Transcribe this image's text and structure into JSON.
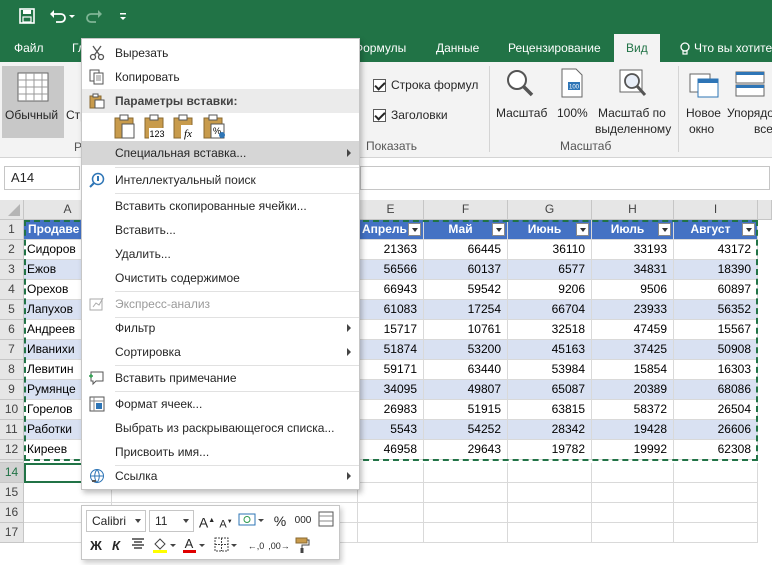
{
  "qat": {
    "save_icon": "save-icon",
    "undo_icon": "undo-icon",
    "redo_icon": "redo-icon",
    "customize_icon": "customize-qat-icon"
  },
  "tabs": [
    {
      "label": "Файл"
    },
    {
      "label": "Гл"
    },
    {
      "label": "Формулы"
    },
    {
      "label": "Данные"
    },
    {
      "label": "Рецензирование"
    },
    {
      "label": "Вид"
    },
    {
      "label": "Что вы хотите"
    }
  ],
  "ribbon": {
    "normal_label": "Обычный",
    "page_label_partial": "Стр",
    "group_partial": "Р",
    "formula_bar_label": "Строка формул",
    "headings_label": "Заголовки",
    "show_group": "Показать",
    "zoom_label": "Масштаб",
    "zoom100_label": "100%",
    "zoom_sel_line1": "Масштаб по",
    "zoom_sel_line2": "выделенному",
    "zoom_group": "Масштаб",
    "new_window_line1": "Новое",
    "new_window_line2": "окно",
    "arrange_line1": "Упорядо",
    "arrange_line2": "все"
  },
  "name_box": "A14",
  "columns": [
    "A",
    "E",
    "F",
    "G",
    "H",
    "I"
  ],
  "table": {
    "headers": [
      "Продаве",
      "Апрель",
      "Май",
      "Июнь",
      "Июль",
      "Август"
    ],
    "rows": [
      [
        "Сидоров",
        "21363",
        "66445",
        "36110",
        "33193",
        "43172"
      ],
      [
        "Ежов",
        "56566",
        "60137",
        "6577",
        "34831",
        "18390"
      ],
      [
        "Орехов",
        "66943",
        "59542",
        "9206",
        "9506",
        "60897"
      ],
      [
        "Лапухов",
        "61083",
        "17254",
        "66704",
        "23933",
        "56352"
      ],
      [
        "Андреев",
        "15717",
        "10761",
        "32518",
        "47459",
        "15567"
      ],
      [
        "Иванихи",
        "51874",
        "53200",
        "45163",
        "37425",
        "50908"
      ],
      [
        "Левитин",
        "59171",
        "63440",
        "53984",
        "15854",
        "16303"
      ],
      [
        "Румянце",
        "34095",
        "49807",
        "65087",
        "20389",
        "68086"
      ],
      [
        "Горелов",
        "26983",
        "51915",
        "63815",
        "58372",
        "26504"
      ],
      [
        "Работки",
        "5543",
        "54252",
        "28342",
        "19428",
        "26606"
      ],
      [
        "Киреев",
        "46958",
        "29643",
        "19782",
        "19992",
        "62308"
      ]
    ]
  },
  "row_numbers": [
    "1",
    "2",
    "3",
    "4",
    "5",
    "6",
    "7",
    "8",
    "9",
    "10",
    "11",
    "12",
    "14",
    "15",
    "16",
    "17"
  ],
  "context_menu": {
    "cut": "Вырезать",
    "copy": "Копировать",
    "paste_options": "Параметры вставки:",
    "paste_special": "Специальная вставка...",
    "smart_lookup": "Интеллектуальный поиск",
    "insert_copied": "Вставить скопированные ячейки...",
    "insert": "Вставить...",
    "delete": "Удалить...",
    "clear": "Очистить содержимое",
    "quick_analysis": "Экспресс-анализ",
    "filter": "Фильтр",
    "sort": "Сортировка",
    "insert_comment": "Вставить примечание",
    "format_cells": "Формат ячеек...",
    "pick_list": "Выбрать из раскрывающегося списка...",
    "define_name": "Присвоить имя...",
    "link": "Ссылка"
  },
  "mini_toolbar": {
    "font": "Calibri",
    "size": "11",
    "bold": "Ж",
    "italic": "К",
    "percent": "%",
    "thousands": "000"
  },
  "colors": {
    "excel_green": "#217346",
    "table_header": "#4472c4",
    "table_band": "#d9e1f2"
  }
}
